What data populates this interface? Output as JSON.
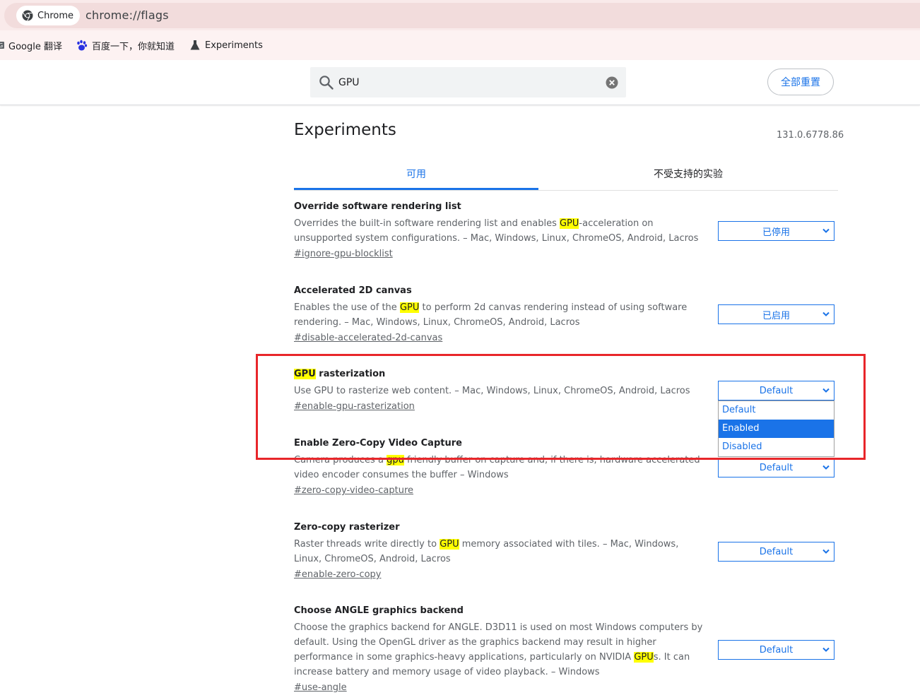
{
  "browser": {
    "chip_label": "Chrome",
    "url": "chrome://flags",
    "bookmarks": [
      {
        "label": "Google 翻译",
        "icon": "google-translate-icon"
      },
      {
        "label": "百度一下，你就知道",
        "icon": "baidu-paw-icon"
      },
      {
        "label": "Experiments",
        "icon": "flask-icon"
      }
    ]
  },
  "header": {
    "search": {
      "value": "GPU",
      "placeholder": ""
    },
    "reset_all_label": "全部重置"
  },
  "page": {
    "title": "Experiments",
    "version": "131.0.6778.86",
    "tabs": [
      {
        "label": "可用",
        "active": true
      },
      {
        "label": "不受支持的实验",
        "active": false
      }
    ]
  },
  "experiments": [
    {
      "title_pre": "",
      "title_mark": "",
      "title_post": "Override software rendering list",
      "desc_pre": "Overrides the built-in software rendering list and enables ",
      "desc_mark": "GPU",
      "desc_post": "-acceleration on unsupported system configurations. – Mac, Windows, Linux, ChromeOS, Android, Lacros",
      "link": "#ignore-gpu-blocklist",
      "value": "已停用"
    },
    {
      "title_pre": "",
      "title_mark": "",
      "title_post": "Accelerated 2D canvas",
      "desc_pre": "Enables the use of the ",
      "desc_mark": "GPU",
      "desc_post": " to perform 2d canvas rendering instead of using software rendering. – Mac, Windows, Linux, ChromeOS, Android, Lacros",
      "link": "#disable-accelerated-2d-canvas",
      "value": "已启用"
    },
    {
      "title_pre": "",
      "title_mark": "GPU",
      "title_post": " rasterization",
      "desc_pre": "Use GPU to rasterize web content. – Mac, Windows, Linux, ChromeOS, Android, Lacros",
      "desc_mark": "",
      "desc_post": "",
      "link": "#enable-gpu-rasterization",
      "value": "Default",
      "dropdown_open": true,
      "options": [
        "Default",
        "Enabled",
        "Disabled"
      ],
      "highlighted_option": "Enabled"
    },
    {
      "title_pre": "",
      "title_mark": "",
      "title_post": "Enable Zero-Copy Video Capture",
      "desc_pre": "Camera produces a ",
      "desc_mark": "gpu",
      "desc_post": " friendly buffer on capture and, if there is, hardware accelerated video encoder consumes the buffer – Windows",
      "link": "#zero-copy-video-capture",
      "value": "Default"
    },
    {
      "title_pre": "",
      "title_mark": "",
      "title_post": "Zero-copy rasterizer",
      "desc_pre": "Raster threads write directly to ",
      "desc_mark": "GPU",
      "desc_post": " memory associated with tiles. – Mac, Windows, Linux, ChromeOS, Android, Lacros",
      "link": "#enable-zero-copy",
      "value": "Default"
    },
    {
      "title_pre": "",
      "title_mark": "",
      "title_post": "Choose ANGLE graphics backend",
      "desc_pre": "Choose the graphics backend for ANGLE. D3D11 is used on most Windows computers by default. Using the OpenGL driver as the graphics backend may result in higher performance in some graphics-heavy applications, particularly on NVIDIA ",
      "desc_mark": "GPU",
      "desc_post": "s. It can increase battery and memory usage of video playback. – Windows",
      "link": "#use-angle",
      "value": "Default"
    }
  ],
  "colors": {
    "accent": "#1a73e8",
    "highlight_mark": "#ffff00",
    "annotation_box": "#e8262a"
  }
}
